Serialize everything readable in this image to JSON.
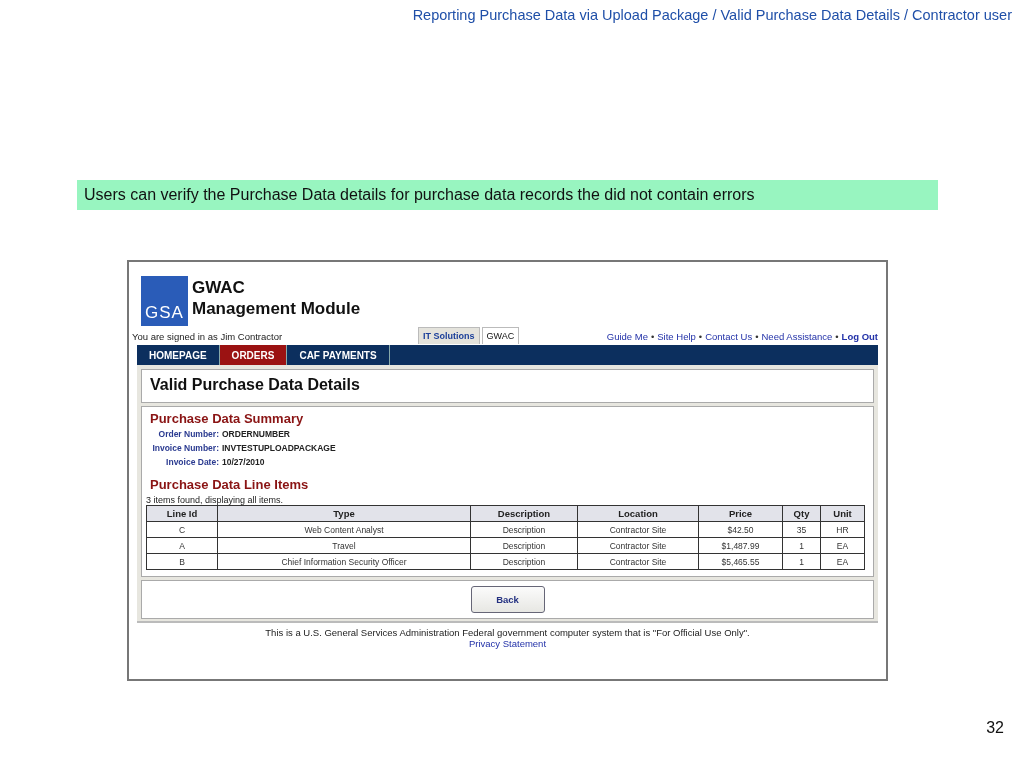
{
  "slide_title": "Reporting Purchase Data via Upload Package / Valid Purchase Data Details / Contractor user",
  "callout": "Users can verify the Purchase Data details for purchase data records the did not contain errors",
  "app": {
    "logo": {
      "mark": "GSA",
      "line1": "GWAC",
      "line2": "Management Module"
    },
    "signed_in": "You are signed in as Jim Contractor",
    "site_tabs": [
      {
        "label": "IT Solutions",
        "selected": false
      },
      {
        "label": "GWAC",
        "selected": true
      }
    ],
    "link_separator": "•",
    "top_links": [
      {
        "label": "Guide Me",
        "bold": false
      },
      {
        "label": "Site Help",
        "bold": false
      },
      {
        "label": "Contact Us",
        "bold": false
      },
      {
        "label": "Need Assistance",
        "bold": false
      },
      {
        "label": "Log Out",
        "bold": true
      }
    ],
    "nav": [
      {
        "label": "HOMEPAGE",
        "selected": false
      },
      {
        "label": "ORDERS",
        "selected": true
      },
      {
        "label": "CAF PAYMENTS",
        "selected": false
      }
    ],
    "page_title": "Valid Purchase Data Details",
    "summary": {
      "heading": "Purchase Data Summary",
      "fields": [
        {
          "label": "Order Number:",
          "value": "ORDERNUMBER"
        },
        {
          "label": "Invoice Number:",
          "value": "INVTESTUPLOADPACKAGE"
        },
        {
          "label": "Invoice Date:",
          "value": "10/27/2010"
        }
      ]
    },
    "line_items": {
      "heading": "Purchase Data Line Items",
      "count_text": "3 items found, displaying all items.",
      "columns": [
        "Line Id",
        "Type",
        "Description",
        "Location",
        "Price",
        "Qty",
        "Unit"
      ],
      "rows": [
        [
          "C",
          "Web Content Analyst",
          "Description",
          "Contractor Site",
          "$42.50",
          "35",
          "HR"
        ],
        [
          "A",
          "Travel",
          "Description",
          "Contractor Site",
          "$1,487.99",
          "1",
          "EA"
        ],
        [
          "B",
          "Chief Information Security Officer",
          "Description",
          "Contractor Site",
          "$5,465.55",
          "1",
          "EA"
        ]
      ]
    },
    "buttons": [
      "Back"
    ],
    "footer": {
      "notice": "This is a U.S. General Services Administration Federal government computer system that is \"For Official Use Only\".",
      "link": "Privacy Statement"
    }
  },
  "page_number": "32"
}
